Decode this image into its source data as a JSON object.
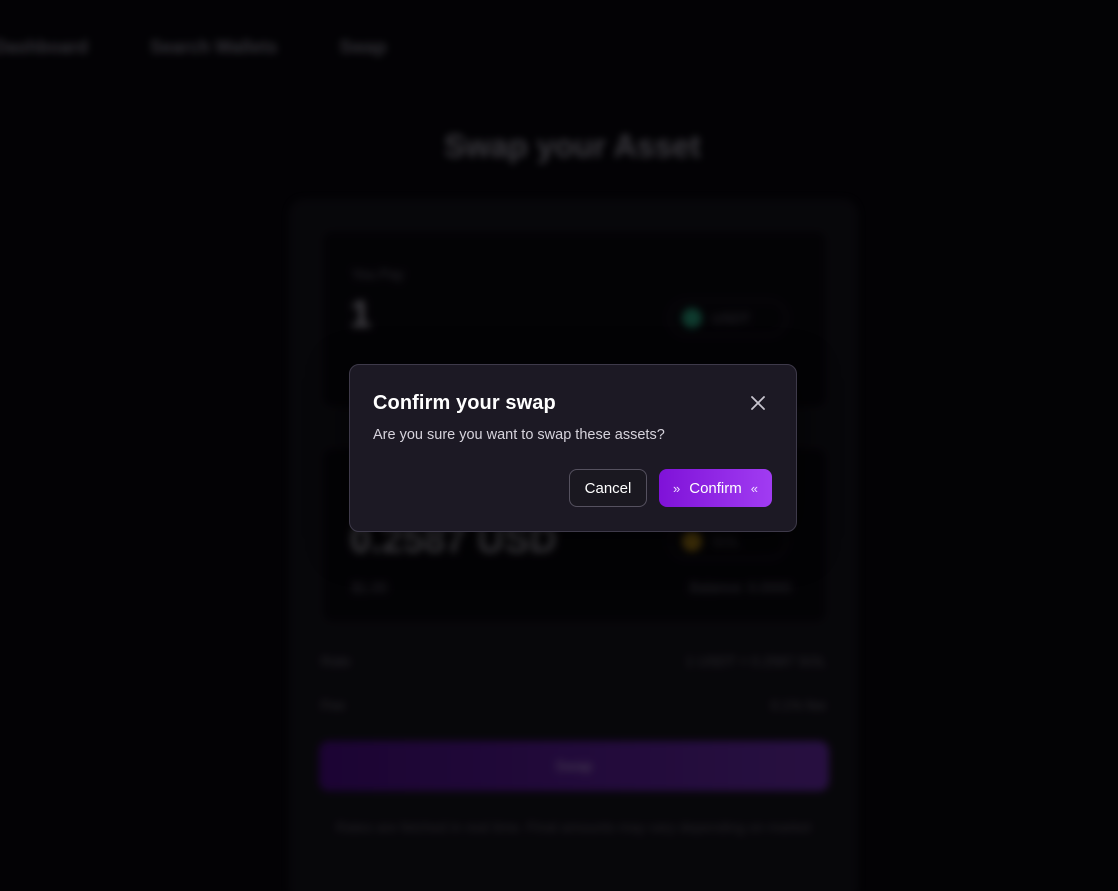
{
  "nav": {
    "items": [
      "Dashboard",
      "Search Wallets",
      "Swap"
    ]
  },
  "background": {
    "page_title": "Swap your Asset",
    "from_panel": {
      "label": "You Pay",
      "amount": "1",
      "token": "USDT",
      "token_color": "#26a17b"
    },
    "to_panel": {
      "amount": "0.2587 USD",
      "sub_label": "$1.00",
      "token": "SOL",
      "token_color": "#d4a017",
      "balance": "Balance: 0.0000"
    },
    "rows": [
      {
        "label": "Rate",
        "value": "1 USDT = 0.2587 SOL"
      },
      {
        "label": "Fee",
        "value": "0.1% fee"
      }
    ],
    "swap_button": "Swap",
    "footnote": "Rates are fetched in real time. Final amounts may vary depending on market"
  },
  "modal": {
    "title": "Confirm your swap",
    "description": "Are you sure you want to swap these assets?",
    "cancel_label": "Cancel",
    "confirm_label": "Confirm",
    "confirm_prefix_icon": "»",
    "confirm_suffix_icon": "«",
    "close_icon": "close-icon",
    "accent_gradient": [
      "#7f12d8",
      "#a13cf2"
    ]
  }
}
